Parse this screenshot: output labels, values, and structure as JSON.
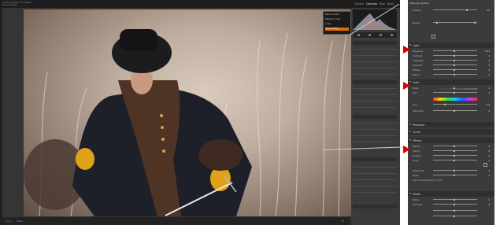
{
  "app": {
    "logo_line1": "Adobe Lightroom Classic",
    "logo_line2": "Denis Kutsyk"
  },
  "modules": [
    "Library",
    "Develop",
    "Map",
    "Book"
  ],
  "active_module": "Develop",
  "status": {
    "left": "Copy",
    "mid": "Paste",
    "zoom": "Fit"
  },
  "popup": {
    "items": [
      "Before & After",
      "Reference View",
      "Loupe",
      "Soft Proofing"
    ],
    "highlight_index": 3
  },
  "zoomed_panel": {
    "header": "Masking Options",
    "header_right": "",
    "top_rows": [
      {
        "label": "Feather",
        "value": "50"
      },
      {
        "label": "Range",
        "value": ""
      }
    ],
    "sections": [
      {
        "name": "Light",
        "value": "",
        "sliders": [
          {
            "label": "Exposure",
            "value": "0.00"
          },
          {
            "label": "Contrast",
            "value": "0"
          },
          {
            "label": "Highlights",
            "value": "0"
          },
          {
            "label": "Shadows",
            "value": "0"
          },
          {
            "label": "Whites",
            "value": "0"
          },
          {
            "label": "Blacks",
            "value": "0"
          }
        ]
      },
      {
        "name": "Color",
        "value": "",
        "sliders": [
          {
            "label": "Temp",
            "value": "0"
          },
          {
            "label": "Tint",
            "value": "0"
          },
          {
            "label": "Hue",
            "value": "0.0"
          },
          {
            "label": "Saturation",
            "value": "0"
          }
        ]
      },
      {
        "name": "Effects",
        "value": "",
        "sliders": [
          {
            "label": "Texture",
            "value": "0"
          },
          {
            "label": "Clarity",
            "value": "0"
          },
          {
            "label": "Dehaze",
            "value": "0"
          },
          {
            "label": "Grain",
            "value": "0"
          }
        ]
      },
      {
        "name": "Detail",
        "value": "",
        "sliders": [
          {
            "label": "Sharpness",
            "value": "0"
          },
          {
            "label": "Noise",
            "value": "0"
          },
          {
            "label": "Moire",
            "value": "0"
          },
          {
            "label": "Defringe",
            "value": "0"
          }
        ]
      }
    ],
    "collapsed_sections": [
      "Presence",
      "Curve"
    ],
    "note": "Use Fine Adjustment for Hue"
  },
  "colors": {
    "accent": "#e06e00",
    "arrow": "#e00000"
  }
}
